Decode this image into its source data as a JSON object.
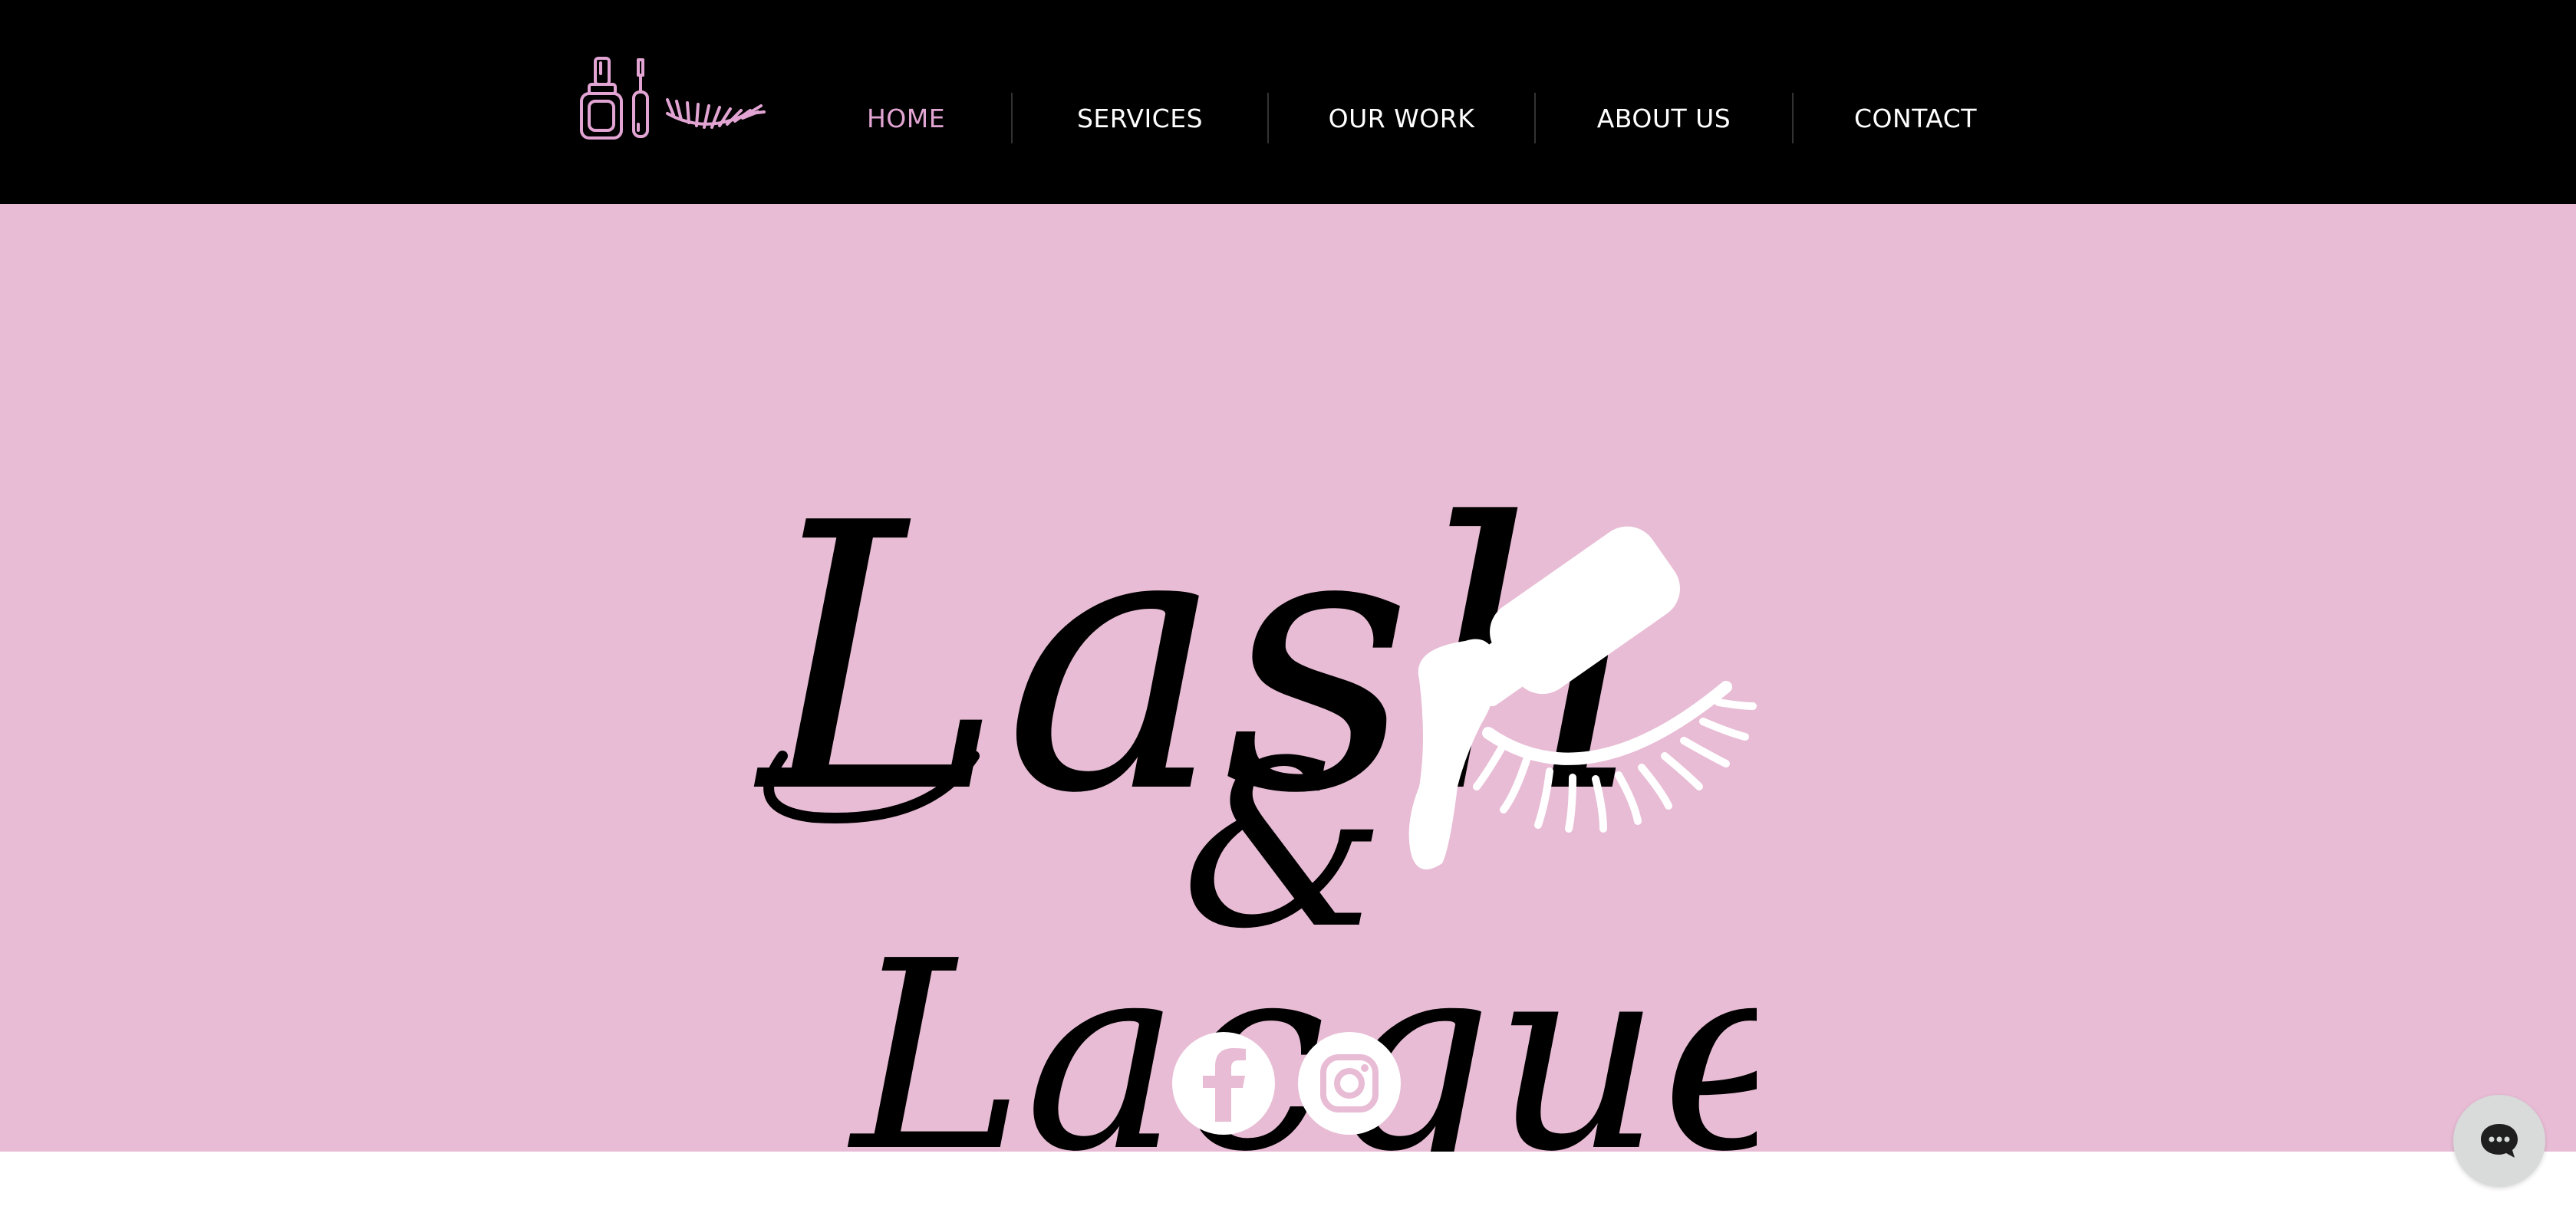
{
  "colors": {
    "header_bg": "#000000",
    "accent_pink": "#e2a5d3",
    "hero_bg": "#e8bcd5",
    "nav_text": "#ffffff"
  },
  "header": {
    "logo_icon": "nail-polish-and-eyelash-icon",
    "nav": [
      {
        "label": "HOME",
        "active": true
      },
      {
        "label": "SERVICES",
        "active": false
      },
      {
        "label": "OUR WORK",
        "active": false
      },
      {
        "label": "ABOUT US",
        "active": false
      },
      {
        "label": "CONTACT",
        "active": false
      }
    ]
  },
  "hero": {
    "logo": {
      "line1": "Lash",
      "ampersand": "&",
      "line2": "Lacquer",
      "icon": "nail-polish-brush-and-eyelash-icon"
    }
  },
  "social": [
    {
      "icon": "facebook-icon"
    },
    {
      "icon": "instagram-icon"
    }
  ],
  "chat": {
    "icon": "chat-bubble-icon"
  }
}
